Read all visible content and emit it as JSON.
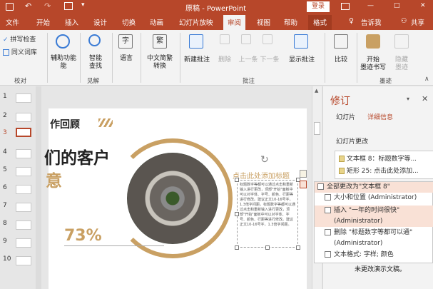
{
  "titlebar": {
    "doc": "原稿",
    "sep": "-",
    "app": "PowerPoint",
    "login": "登录",
    "minimize": "—",
    "restore": "□",
    "close": "✕"
  },
  "tabs": [
    "文件",
    "开始",
    "插入",
    "设计",
    "切换",
    "动画",
    "幻灯片放映",
    "审阅",
    "视图",
    "帮助",
    "格式"
  ],
  "tell_me": "告诉我",
  "share": "共享",
  "ribbon": {
    "spellcheck": "拼写检查",
    "thesaurus": "同义词库",
    "group_proofing": "校对",
    "accessibility": "辅助功能",
    "accessibility_l2": "能",
    "smart_lookup": "智能",
    "smart_lookup_l2": "查找",
    "group_insights": "见解",
    "language": "语言",
    "chinese_conv": "中文简繁",
    "chinese_conv_l2": "转换",
    "new_comment": "新建批注",
    "delete": "删除",
    "prev": "上一条",
    "next": "下一条",
    "show_comments": "显示批注",
    "group_comments": "批注",
    "compare": "比较",
    "start_ink": "开始",
    "start_ink_l2": "墨迹书写",
    "hide_ink": "隐藏",
    "hide_ink_l2": "墨迹",
    "group_ink": "墨迹"
  },
  "thumbnails": [
    "1",
    "2",
    "3",
    "4",
    "5",
    "6",
    "7",
    "8",
    "9",
    "10"
  ],
  "slide": {
    "heading": "作回顾",
    "big1": "们的客户",
    "big2": "意",
    "percent": "73%",
    "placeholder": "点击此处添加标题",
    "body": "标题数字等都可以通过点击和重新输入进行更改，顶部\"开始\"面板中可以对字体、字号、颜色、行距等进行修改。建议正文10-16号字，1.3倍字间距。标题数字等都可以通过点击和重新输入进行更改，顶部\"开始\"面板中可以对字体、字号、颜色、行距等进行修改。建议正文10-16号字，1.3倍字间距。"
  },
  "panel": {
    "title": "修订",
    "tab_slides": "幻灯片",
    "tab_details": "详细信息",
    "section": "幻灯片更改",
    "changes": [
      "文本框 8：标题数字等...",
      "矩形 25: 点击此处添加..."
    ]
  },
  "popup": {
    "all": "全部更改为\"文本框 8\"",
    "items": [
      "大小和位置 (Administrator)",
      "插入 \"一年的时间很快\"",
      "(Administrator)",
      "删除 \"标题数字等都可以通\"",
      "(Administrator)",
      "文本格式: 字样; 颜色"
    ],
    "footer": "未更改演示文稿。"
  },
  "colors": {
    "accent": "#b7472a",
    "gold": "#c9a063",
    "dark": "#222222"
  },
  "icons": [
    "undo-icon",
    "redo-icon",
    "save-icon",
    "check-icon",
    "book-icon",
    "search-icon",
    "language-icon",
    "comment-icon",
    "delete-icon",
    "prev-icon",
    "next-icon",
    "compare-icon",
    "ink-icon",
    "lightbulb-icon",
    "person-icon",
    "close-icon",
    "comment-marker-icon"
  ]
}
